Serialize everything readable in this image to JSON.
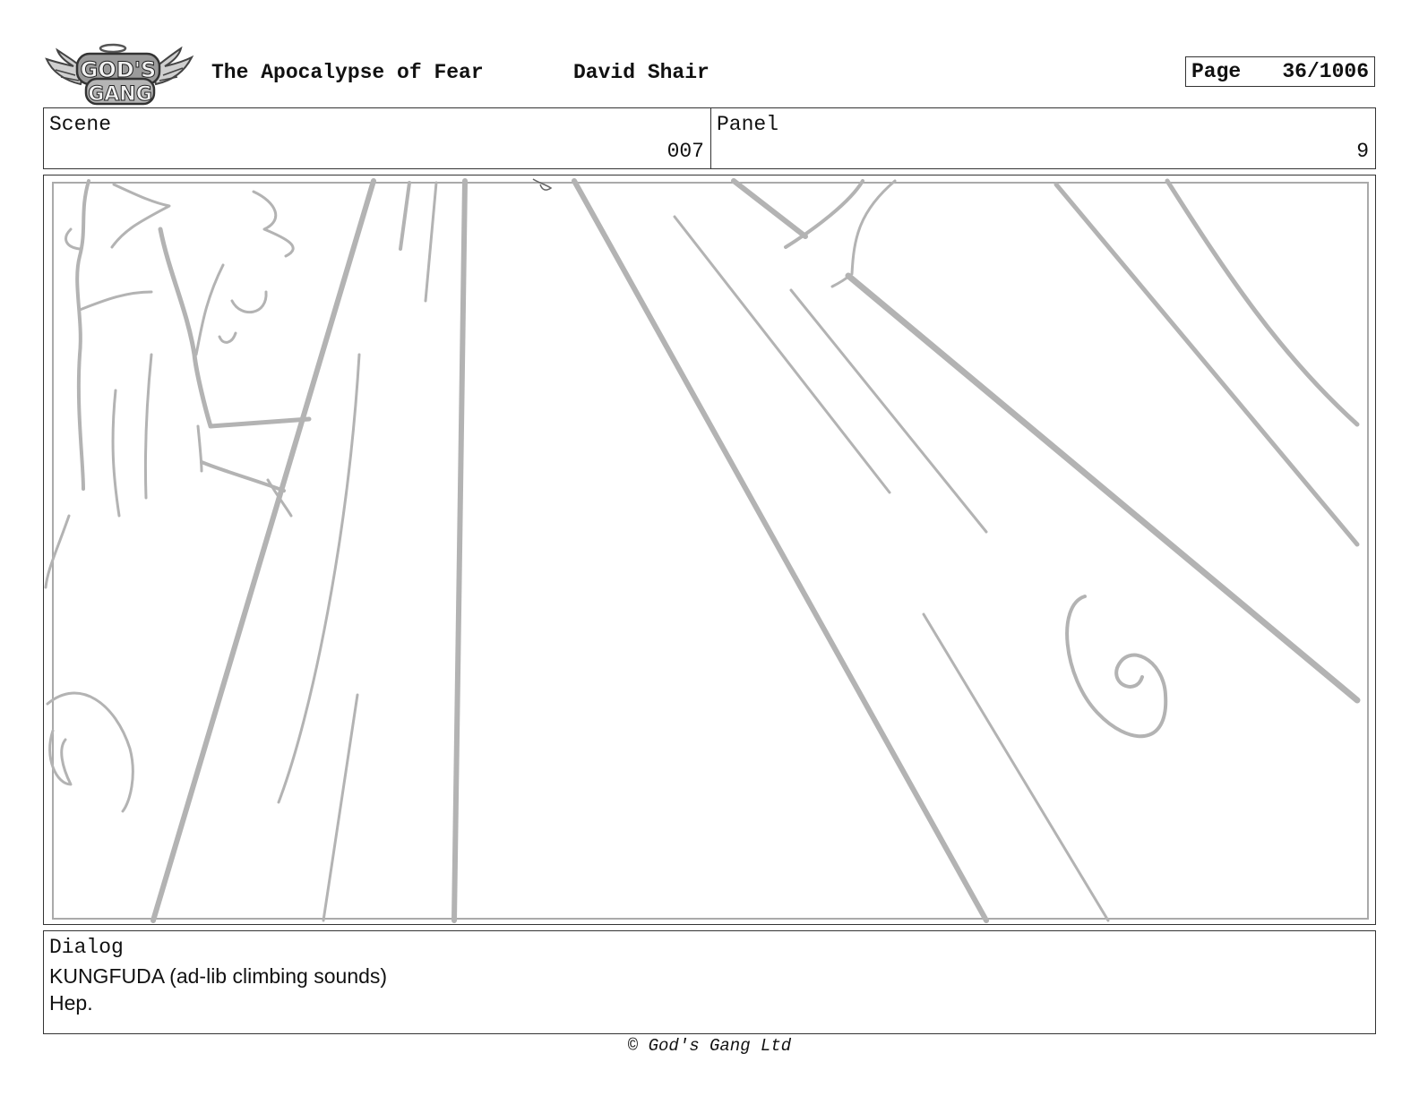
{
  "header": {
    "logo_text": "GOD'S GANG",
    "show_title": "The Apocalypse of Fear",
    "author": "David Shair",
    "page_label": "Page",
    "page_number": "36/1006"
  },
  "info": {
    "scene_label": "Scene",
    "scene_value": "007",
    "panel_label": "Panel",
    "panel_value": "9"
  },
  "dialog": {
    "label": "Dialog",
    "lines": [
      "KUNGFUDA (ad-lib climbing sounds)",
      "Hep."
    ]
  },
  "footer": {
    "copyright": "© God's Gang Ltd"
  }
}
